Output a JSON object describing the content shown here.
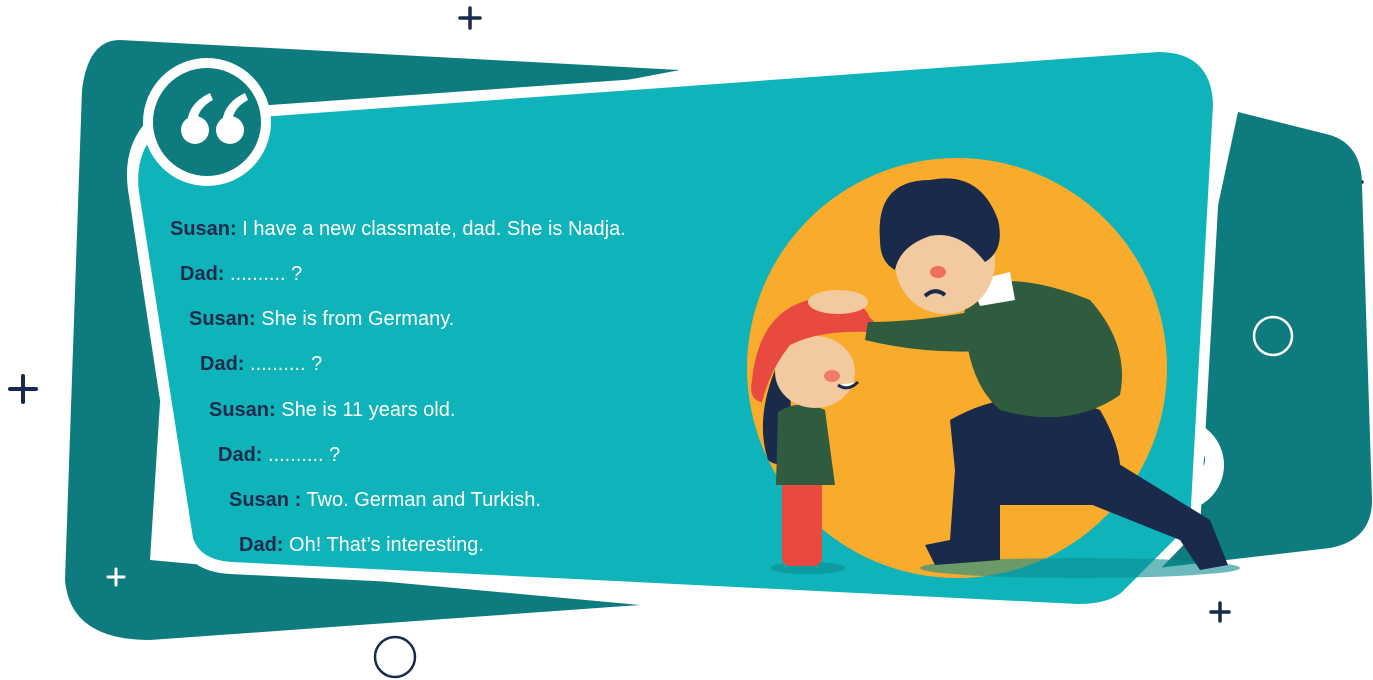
{
  "dialogue": [
    {
      "speaker": "Susan:",
      "text": " I have a new classmate, dad. She is Nadja."
    },
    {
      "speaker": "Dad:",
      "text": " .......... ?"
    },
    {
      "speaker": "Susan:",
      "text": " She is from Germany."
    },
    {
      "speaker": "Dad:",
      "text": " .......... ?"
    },
    {
      "speaker": "Susan:",
      "text": " She is 11 years old."
    },
    {
      "speaker": "Dad:",
      "text": " .......... ?"
    },
    {
      "speaker": "Susan :",
      "text": " Two. German and Turkish."
    },
    {
      "speaker": "Dad:",
      "text": " Oh! That’s interesting."
    }
  ],
  "colors": {
    "dark_teal": "#0e7b7e",
    "light_teal": "#0fb3ba",
    "accent_orange": "#f9ac2b",
    "navy": "#1a2a4a",
    "white": "#ffffff"
  },
  "icons": {
    "open_quote": "quote-open-icon",
    "close_quote": "quote-close-icon",
    "plus": "plus-icon",
    "circle": "circle-outline-icon"
  }
}
